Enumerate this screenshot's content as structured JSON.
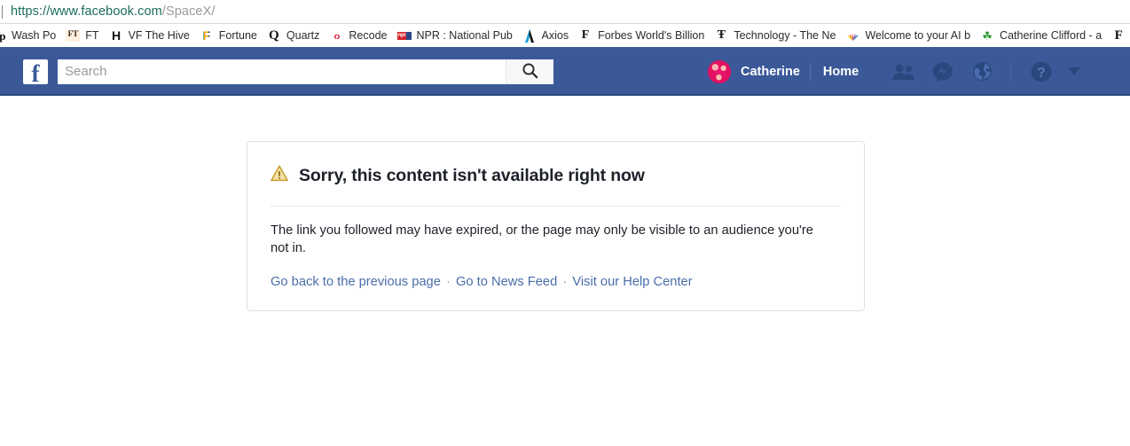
{
  "browser": {
    "url_host": "https://www.facebook.com",
    "url_path": "/SpaceX/",
    "bookmarks": [
      {
        "label": "Wash Po",
        "icon": "washington-post-icon",
        "icon_text": "ᵂp",
        "clip": 0
      },
      {
        "label": "FT",
        "icon": "financial-times-icon",
        "icon_text": "FT",
        "clip": 0
      },
      {
        "label": "VF The Hive",
        "icon": "vanity-fair-hive-icon",
        "icon_text": "H",
        "clip": 0
      },
      {
        "label": "Fortune",
        "icon": "fortune-icon",
        "icon_text": "F",
        "clip": 0
      },
      {
        "label": "Quartz",
        "icon": "quartz-icon",
        "icon_text": "Q",
        "clip": 0
      },
      {
        "label": "Recode",
        "icon": "recode-icon",
        "icon_text": "‹›",
        "clip": 0
      },
      {
        "label": "NPR : National Public",
        "icon": "npr-icon",
        "icon_text": "npr",
        "clip": 1
      },
      {
        "label": "Axios",
        "icon": "axios-icon",
        "icon_text": "A",
        "clip": 0
      },
      {
        "label": "Forbes World's Billion",
        "icon": "forbes-icon",
        "icon_text": "F",
        "clip": 2
      },
      {
        "label": "Technology - The Ne",
        "icon": "new-york-times-icon",
        "icon_text": "Ŧ",
        "clip": 4
      },
      {
        "label": "Welcome to your AI b",
        "icon": "nbc-peacock-icon",
        "icon_text": "",
        "clip": 5
      },
      {
        "label": "Catherine Clifford - a",
        "icon": "leaf-icon",
        "icon_text": "☘",
        "clip": 5
      },
      {
        "label": "F",
        "icon": "forbes-icon",
        "icon_text": "",
        "clip": 6
      }
    ]
  },
  "facebook": {
    "logo_letter": "f",
    "search": {
      "placeholder": "Search",
      "value": "",
      "button_icon": "search-icon"
    },
    "nav": {
      "profile_name": "Catherine",
      "home_label": "Home",
      "icons": [
        {
          "name": "friend-requests-icon"
        },
        {
          "name": "messenger-icon"
        },
        {
          "name": "notifications-globe-icon"
        },
        {
          "name": "help-icon"
        },
        {
          "name": "account-dropdown-caret-icon"
        }
      ]
    }
  },
  "error_card": {
    "warning_icon": "warning-triangle-icon",
    "heading": "Sorry, this content isn't available right now",
    "body": "The link you followed may have expired, or the page may only be visible to an audience you're not in.",
    "links": [
      {
        "label": "Go back to the previous page"
      },
      {
        "label": "Go to News Feed"
      },
      {
        "label": "Visit our Help Center"
      }
    ],
    "link_separator": "·"
  },
  "colors": {
    "fb_blue": "#3b5998",
    "fb_blue_dark": "#29487d",
    "link_blue": "#4b6ea9",
    "warning_gold": "#d4a02a",
    "card_border": "#dddfe2",
    "text_dark": "#1d2129"
  }
}
